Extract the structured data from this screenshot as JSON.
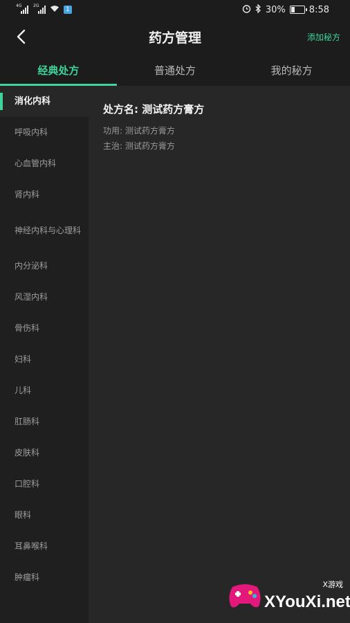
{
  "status_bar": {
    "signal1_label": "4G",
    "signal2_label": "2G",
    "sim_badge": "1",
    "battery_percent": "30%",
    "battery_level": 0.3,
    "time": "8:58"
  },
  "header": {
    "title": "药方管理",
    "add_label": "添加秘方"
  },
  "tabs": [
    {
      "label": "经典处方",
      "active": true
    },
    {
      "label": "普通处方",
      "active": false
    },
    {
      "label": "我的秘方",
      "active": false
    }
  ],
  "sidebar": {
    "items": [
      {
        "label": "消化内科"
      },
      {
        "label": "呼吸内科"
      },
      {
        "label": "心血管内科"
      },
      {
        "label": "肾内科"
      },
      {
        "label": "神经内科与心理科"
      },
      {
        "label": "内分泌科"
      },
      {
        "label": "风湿内科"
      },
      {
        "label": "骨伤科"
      },
      {
        "label": "妇科"
      },
      {
        "label": "儿科"
      },
      {
        "label": "肛肠科"
      },
      {
        "label": "皮肤科"
      },
      {
        "label": "口腔科"
      },
      {
        "label": "眼科"
      },
      {
        "label": "耳鼻喉科"
      },
      {
        "label": "肿瘤科"
      }
    ]
  },
  "prescription": {
    "name": "处方名: 测试药方膏方",
    "function": "功用: 测试药方膏方",
    "indication": "主治: 测试药方膏方"
  },
  "watermark": {
    "brand": "XYouXi.net",
    "brand_cn": "X游戏"
  },
  "colors": {
    "accent": "#3ed39a",
    "background": "#272727",
    "sidebar": "#1f1f1f",
    "bar": "#1c1c1c"
  }
}
